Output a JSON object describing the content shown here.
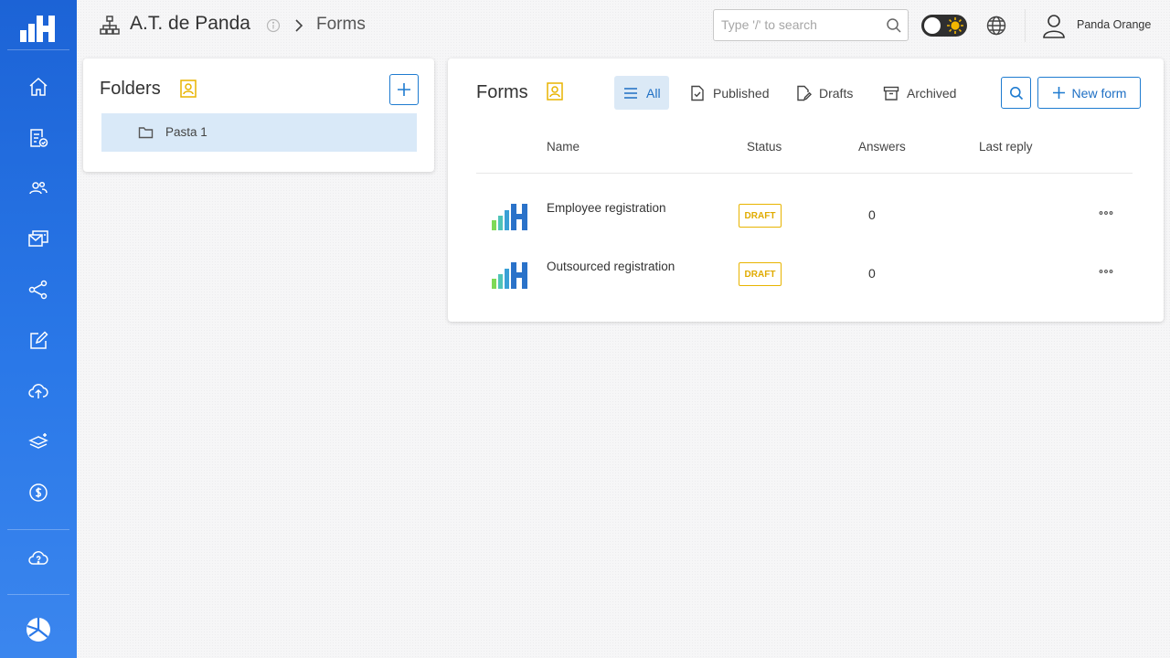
{
  "app": {
    "brand_color": "#1c63d6",
    "accent_color": "#1e7bd0",
    "warning_color": "#e8b400"
  },
  "header": {
    "org_name": "A.T. de Panda",
    "page": "Forms",
    "search_placeholder": "Type '/' to search",
    "search_value": "",
    "user_name": "Panda Orange",
    "theme_toggle": "light"
  },
  "sidebar": {
    "items": [
      {
        "icon": "home-icon"
      },
      {
        "icon": "forms-check-icon"
      },
      {
        "icon": "users-icon"
      },
      {
        "icon": "mail-inbox-icon"
      },
      {
        "icon": "share-icon"
      },
      {
        "icon": "edit-icon"
      },
      {
        "icon": "cloud-upload-icon"
      },
      {
        "icon": "layers-add-icon"
      },
      {
        "icon": "dollar-icon"
      },
      {
        "icon": "cloud-help-icon"
      },
      {
        "icon": "pie-chart-icon"
      }
    ]
  },
  "folders": {
    "title": "Folders",
    "items": [
      {
        "label": "Pasta 1",
        "selected": true
      }
    ]
  },
  "forms": {
    "title": "Forms",
    "tabs": [
      {
        "label": "All",
        "active": true
      },
      {
        "label": "Published",
        "active": false
      },
      {
        "label": "Drafts",
        "active": false
      },
      {
        "label": "Archived",
        "active": false
      }
    ],
    "new_form_label": "New form",
    "columns": {
      "name": "Name",
      "status": "Status",
      "answers": "Answers",
      "last_reply": "Last reply"
    },
    "rows": [
      {
        "name": "Employee registration",
        "status": "DRAFT",
        "answers": "0",
        "last_reply": ""
      },
      {
        "name": "Outsourced registration",
        "status": "DRAFT",
        "answers": "0",
        "last_reply": ""
      }
    ]
  }
}
